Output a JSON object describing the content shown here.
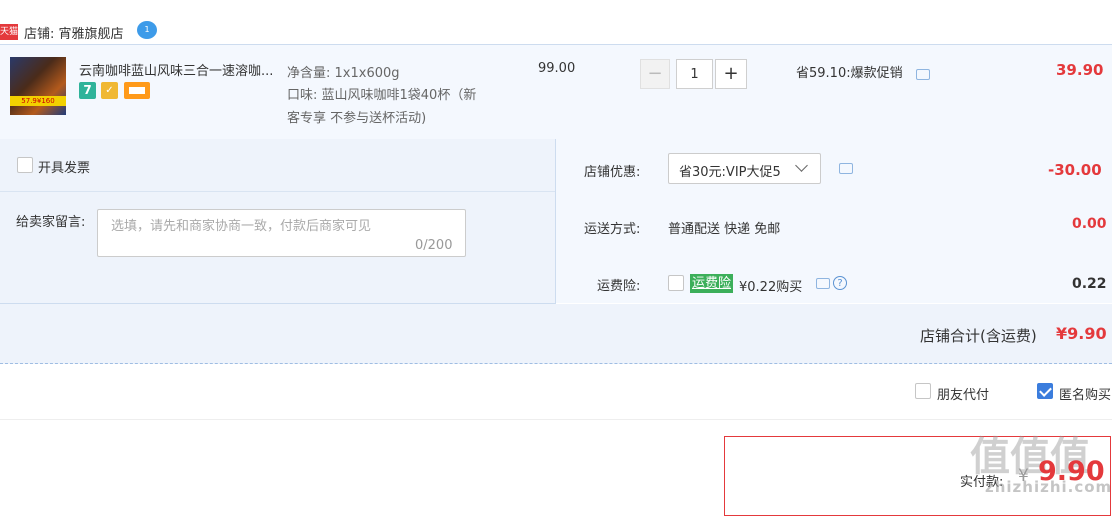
{
  "shop": {
    "platform_badge": "天猫",
    "name": "店铺: 宵雅旗舰店",
    "chat_badge": "1"
  },
  "item": {
    "title": "云南咖啡蓝山风味三合一速溶咖...",
    "thumb_badge": "57.9¥160",
    "sku_weight": "净含量: 1x1x600g",
    "sku_flavor_line1": "口味: 蓝山风味咖啡1袋40杯（新",
    "sku_flavor_line2": "客专享 不参与送杯活动)",
    "unit_price": "99.00",
    "quantity": "1",
    "minus": "−",
    "plus": "+",
    "promo": "省59.10:爆款促销",
    "subtotal": "39.90"
  },
  "invoice": {
    "label": "开具发票"
  },
  "memo": {
    "label": "给卖家留言:",
    "placeholder": "选填，请先和商家协商一致，付款后商家可见",
    "counter": "0/200"
  },
  "coupon": {
    "label": "店铺优惠:",
    "selected": "省30元:VIP大促5",
    "value": "-30.00"
  },
  "shipping": {
    "label": "运送方式:",
    "method": "普通配送 快递 免邮",
    "value": "0.00"
  },
  "insurance": {
    "label": "运费险:",
    "badge": "运费险",
    "price_text": "¥0.22购买",
    "help": "?",
    "value": "0.22"
  },
  "shop_total": {
    "label": "店铺合计(含运费)",
    "value": "¥9.90"
  },
  "options": {
    "friend_pay": "朋友代付",
    "anonymous": "匿名购买"
  },
  "pay": {
    "label": "实付款:",
    "currency": "¥",
    "value": "9.90"
  },
  "watermark": {
    "glyphs": "值值值",
    "url": "zhizhizhi.com"
  },
  "colors": {
    "accent_red": "#e4393c",
    "panel_blue": "#eef3fb",
    "insurance_green": "#3caf5a",
    "checkbox_blue": "#3b7ddd"
  }
}
